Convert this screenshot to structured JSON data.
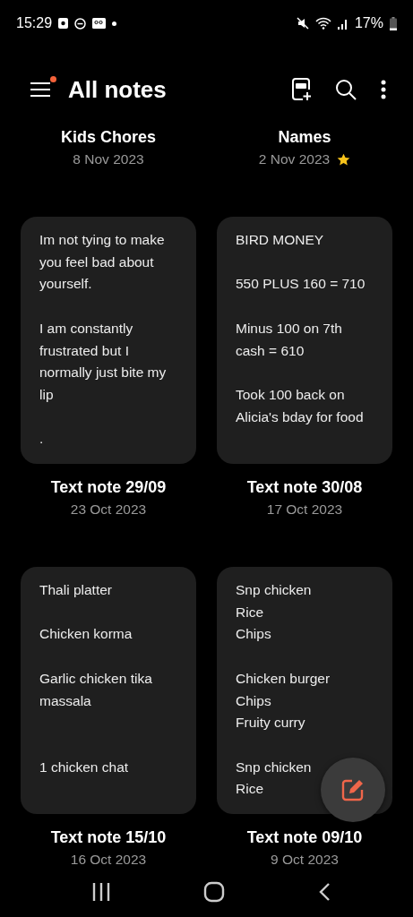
{
  "status_bar": {
    "time": "15:29",
    "battery": "17%"
  },
  "header": {
    "title": "All notes",
    "menu_notification": true
  },
  "notes": [
    {
      "title": "Kids Chores",
      "date": "8 Nov 2023",
      "favorite": false
    },
    {
      "title": "Names",
      "date": "2 Nov 2023",
      "favorite": true
    },
    {
      "title": "Text note 29/09",
      "date": "23 Oct 2023",
      "favorite": false,
      "preview": "Im not tying to make\nyou feel bad about\nyourself.\n\nI am constantly\nfrustrated but I\nnormally just bite my\nlip\n\n."
    },
    {
      "title": "Text note 30/08",
      "date": "17 Oct 2023",
      "favorite": false,
      "preview": "BIRD MONEY\n\n550 PLUS 160 = 710\n\nMinus 100 on 7th\ncash = 610\n\nTook 100 back on\nAlicia's bday for food"
    },
    {
      "title": "Text note 15/10",
      "date": "16 Oct 2023",
      "favorite": false,
      "preview": "Thali platter\n\nChicken korma\n\nGarlic chicken tika\nmassala\n\n\n1 chicken chat"
    },
    {
      "title": "Text note 09/10",
      "date": "9 Oct 2023",
      "favorite": false,
      "preview": "Snp chicken\nRice\nChips\n\nChicken burger\nChips\nFruity curry\n\nSnp chicken\nRice"
    }
  ]
}
